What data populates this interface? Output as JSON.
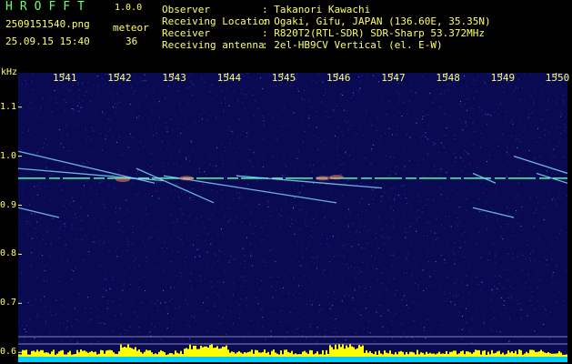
{
  "header": {
    "app_name": "HROFFT",
    "app_version": "1.0.0",
    "file_name": "2509151540.png",
    "date_time": "25.09.15 15:40",
    "category_label": "meteor",
    "category_count": "36"
  },
  "station_info": [
    {
      "key": "Observer",
      "value": ": Takanori Kawachi"
    },
    {
      "key": "Receiving Location",
      "value": ": Ogaki, Gifu, JAPAN (136.60E, 35.35N)"
    },
    {
      "key": "Receiver",
      "value": ": R820T2(RTL-SDR) SDR-Sharp 53.372MHz"
    },
    {
      "key": "Receiving antenna",
      "value": ": 2el-HB9CV Vertical (el. E-W)"
    }
  ],
  "chart_data": {
    "type": "heatmap",
    "xlabel": "",
    "ylabel": "kHz",
    "x_ticks": [
      "1541",
      "1542",
      "1543",
      "1544",
      "1545",
      "1546",
      "1547",
      "1548",
      "1549",
      "1550"
    ],
    "y_ticks": [
      "1.1",
      "1.0",
      "0.9",
      "0.8",
      "0.7",
      "0.6"
    ],
    "ylim": [
      0.58,
      1.17
    ],
    "colors": {
      "background": "#0a0a52",
      "trace": "#88ddff",
      "carrier": "#44ffaa",
      "level": "#ffff00",
      "floor": "#00ccff"
    }
  }
}
